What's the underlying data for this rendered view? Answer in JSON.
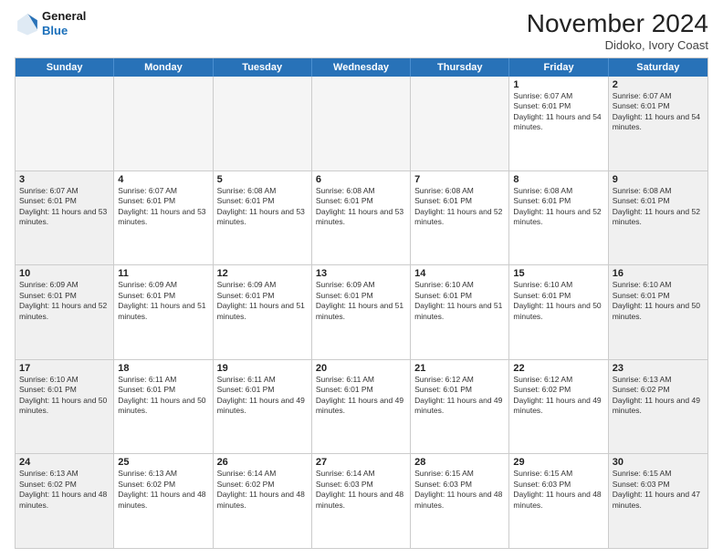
{
  "logo": {
    "line1": "General",
    "line2": "Blue"
  },
  "header": {
    "month": "November 2024",
    "location": "Didoko, Ivory Coast"
  },
  "weekdays": [
    "Sunday",
    "Monday",
    "Tuesday",
    "Wednesday",
    "Thursday",
    "Friday",
    "Saturday"
  ],
  "rows": [
    [
      {
        "day": "",
        "empty": true
      },
      {
        "day": "",
        "empty": true
      },
      {
        "day": "",
        "empty": true
      },
      {
        "day": "",
        "empty": true
      },
      {
        "day": "",
        "empty": true
      },
      {
        "day": "1",
        "sunrise": "6:07 AM",
        "sunset": "6:01 PM",
        "daylight": "11 hours and 54 minutes."
      },
      {
        "day": "2",
        "sunrise": "6:07 AM",
        "sunset": "6:01 PM",
        "daylight": "11 hours and 54 minutes."
      }
    ],
    [
      {
        "day": "3",
        "sunrise": "6:07 AM",
        "sunset": "6:01 PM",
        "daylight": "11 hours and 53 minutes."
      },
      {
        "day": "4",
        "sunrise": "6:07 AM",
        "sunset": "6:01 PM",
        "daylight": "11 hours and 53 minutes."
      },
      {
        "day": "5",
        "sunrise": "6:08 AM",
        "sunset": "6:01 PM",
        "daylight": "11 hours and 53 minutes."
      },
      {
        "day": "6",
        "sunrise": "6:08 AM",
        "sunset": "6:01 PM",
        "daylight": "11 hours and 53 minutes."
      },
      {
        "day": "7",
        "sunrise": "6:08 AM",
        "sunset": "6:01 PM",
        "daylight": "11 hours and 52 minutes."
      },
      {
        "day": "8",
        "sunrise": "6:08 AM",
        "sunset": "6:01 PM",
        "daylight": "11 hours and 52 minutes."
      },
      {
        "day": "9",
        "sunrise": "6:08 AM",
        "sunset": "6:01 PM",
        "daylight": "11 hours and 52 minutes."
      }
    ],
    [
      {
        "day": "10",
        "sunrise": "6:09 AM",
        "sunset": "6:01 PM",
        "daylight": "11 hours and 52 minutes."
      },
      {
        "day": "11",
        "sunrise": "6:09 AM",
        "sunset": "6:01 PM",
        "daylight": "11 hours and 51 minutes."
      },
      {
        "day": "12",
        "sunrise": "6:09 AM",
        "sunset": "6:01 PM",
        "daylight": "11 hours and 51 minutes."
      },
      {
        "day": "13",
        "sunrise": "6:09 AM",
        "sunset": "6:01 PM",
        "daylight": "11 hours and 51 minutes."
      },
      {
        "day": "14",
        "sunrise": "6:10 AM",
        "sunset": "6:01 PM",
        "daylight": "11 hours and 51 minutes."
      },
      {
        "day": "15",
        "sunrise": "6:10 AM",
        "sunset": "6:01 PM",
        "daylight": "11 hours and 50 minutes."
      },
      {
        "day": "16",
        "sunrise": "6:10 AM",
        "sunset": "6:01 PM",
        "daylight": "11 hours and 50 minutes."
      }
    ],
    [
      {
        "day": "17",
        "sunrise": "6:10 AM",
        "sunset": "6:01 PM",
        "daylight": "11 hours and 50 minutes."
      },
      {
        "day": "18",
        "sunrise": "6:11 AM",
        "sunset": "6:01 PM",
        "daylight": "11 hours and 50 minutes."
      },
      {
        "day": "19",
        "sunrise": "6:11 AM",
        "sunset": "6:01 PM",
        "daylight": "11 hours and 49 minutes."
      },
      {
        "day": "20",
        "sunrise": "6:11 AM",
        "sunset": "6:01 PM",
        "daylight": "11 hours and 49 minutes."
      },
      {
        "day": "21",
        "sunrise": "6:12 AM",
        "sunset": "6:01 PM",
        "daylight": "11 hours and 49 minutes."
      },
      {
        "day": "22",
        "sunrise": "6:12 AM",
        "sunset": "6:02 PM",
        "daylight": "11 hours and 49 minutes."
      },
      {
        "day": "23",
        "sunrise": "6:13 AM",
        "sunset": "6:02 PM",
        "daylight": "11 hours and 49 minutes."
      }
    ],
    [
      {
        "day": "24",
        "sunrise": "6:13 AM",
        "sunset": "6:02 PM",
        "daylight": "11 hours and 48 minutes."
      },
      {
        "day": "25",
        "sunrise": "6:13 AM",
        "sunset": "6:02 PM",
        "daylight": "11 hours and 48 minutes."
      },
      {
        "day": "26",
        "sunrise": "6:14 AM",
        "sunset": "6:02 PM",
        "daylight": "11 hours and 48 minutes."
      },
      {
        "day": "27",
        "sunrise": "6:14 AM",
        "sunset": "6:03 PM",
        "daylight": "11 hours and 48 minutes."
      },
      {
        "day": "28",
        "sunrise": "6:15 AM",
        "sunset": "6:03 PM",
        "daylight": "11 hours and 48 minutes."
      },
      {
        "day": "29",
        "sunrise": "6:15 AM",
        "sunset": "6:03 PM",
        "daylight": "11 hours and 48 minutes."
      },
      {
        "day": "30",
        "sunrise": "6:15 AM",
        "sunset": "6:03 PM",
        "daylight": "11 hours and 47 minutes."
      }
    ]
  ],
  "labels": {
    "sunrise": "Sunrise:",
    "sunset": "Sunset:",
    "daylight": "Daylight:"
  }
}
